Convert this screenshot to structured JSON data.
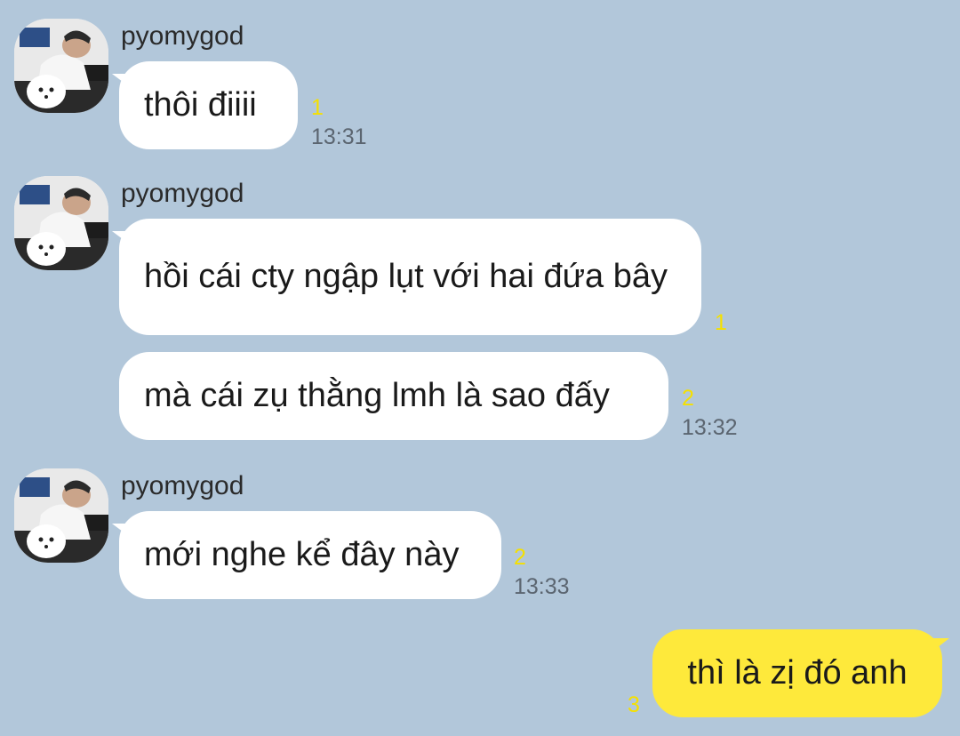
{
  "colors": {
    "background": "#b2c7da",
    "incoming_bubble": "#ffffff",
    "outgoing_bubble": "#fee93b",
    "unread_count": "#f5e000",
    "timestamp": "#5b6570"
  },
  "groups": [
    {
      "sender": "pyomygod",
      "avatar_icon": "profile-photo-avatar",
      "messages": [
        {
          "text": "thôi điiii",
          "unread": "1",
          "time": "13:31"
        }
      ]
    },
    {
      "sender": "pyomygod",
      "avatar_icon": "profile-photo-avatar",
      "messages": [
        {
          "text": "hồi cái cty ngập lụt với hai đứa bây",
          "unread": "1"
        },
        {
          "text": "mà cái zụ thằng lmh là sao đấy",
          "unread": "2",
          "time": "13:32"
        }
      ]
    },
    {
      "sender": "pyomygod",
      "avatar_icon": "profile-photo-avatar",
      "messages": [
        {
          "text": "mới nghe kể đây này",
          "unread": "2",
          "time": "13:33"
        }
      ]
    }
  ],
  "outgoing": [
    {
      "text": "thì là zị đó anh",
      "unread": "3"
    }
  ]
}
